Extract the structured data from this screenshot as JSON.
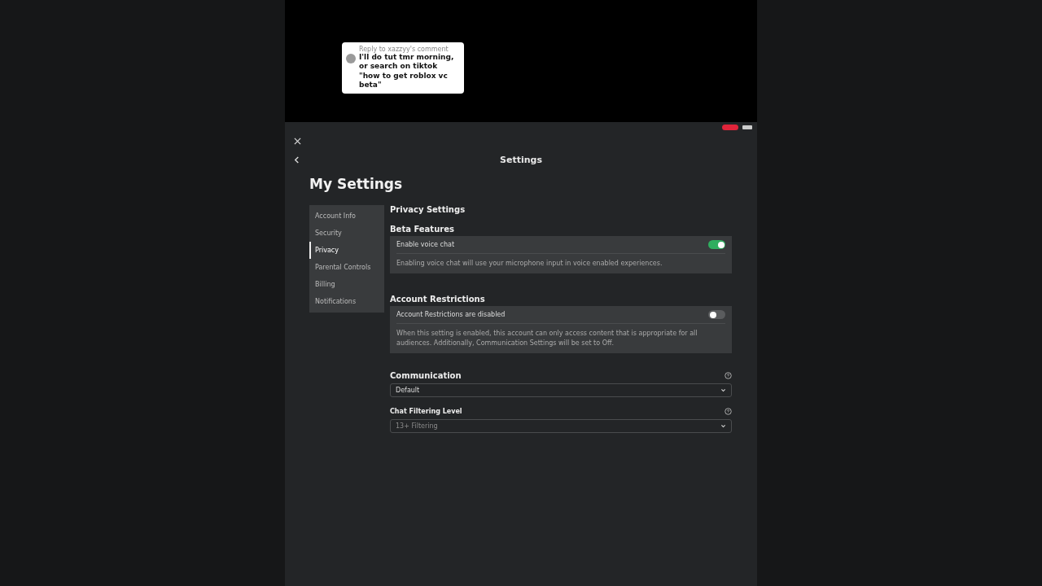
{
  "comment_bubble": {
    "header": "Reply to xazzyy's comment",
    "text": "I'll do tut tmr morning, or search on tiktok \"how to get roblox vc beta\""
  },
  "header": {
    "title": "Settings"
  },
  "page_title": "My Settings",
  "sidebar": {
    "items": [
      {
        "label": "Account Info",
        "selected": false
      },
      {
        "label": "Security",
        "selected": false
      },
      {
        "label": "Privacy",
        "selected": true
      },
      {
        "label": "Parental Controls",
        "selected": false
      },
      {
        "label": "Billing",
        "selected": false
      },
      {
        "label": "Notifications",
        "selected": false
      }
    ]
  },
  "section_title": "Privacy Settings",
  "groups": [
    {
      "title": "Beta Features",
      "label": "Enable voice chat",
      "on": true,
      "description": "Enabling voice chat will use your microphone input in voice enabled experiences."
    },
    {
      "title": "Account Restrictions",
      "label": "Account Restrictions are disabled",
      "on": false,
      "description": "When this setting is enabled, this account can only access content that is appropriate for all audiences. Additionally, Communication Settings will be set to Off."
    }
  ],
  "dropdowns": [
    {
      "label": "Communication",
      "value": "Default",
      "disabled": false
    },
    {
      "label": "Chat Filtering Level",
      "value": "13+ Filtering",
      "disabled": true
    }
  ]
}
